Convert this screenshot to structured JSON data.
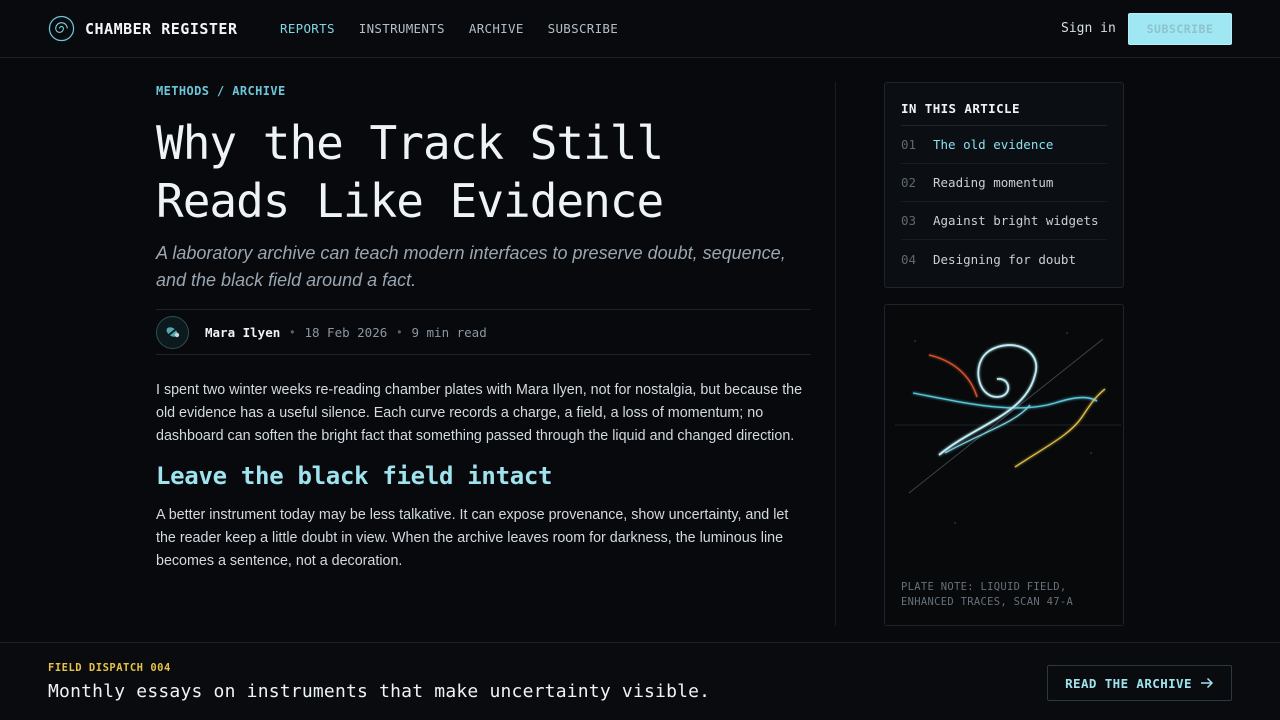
{
  "brand": {
    "name": "CHAMBER REGISTER",
    "logo_icon": "spiral-logo-icon"
  },
  "nav": {
    "items": [
      {
        "label": "REPORTS",
        "active": true
      },
      {
        "label": "INSTRUMENTS",
        "active": false
      },
      {
        "label": "ARCHIVE",
        "active": false
      },
      {
        "label": "SUBSCRIBE",
        "active": false
      }
    ],
    "sign_in": "Sign in",
    "subscribe_button": "SUBSCRIBE"
  },
  "article": {
    "breadcrumb": "METHODS / ARCHIVE",
    "title_line1": "Why the Track Still",
    "title_line2": "Reads Like Evidence",
    "dek": "A laboratory archive can teach modern interfaces to preserve doubt, sequence, and the black field around a fact.",
    "author": "Mara Ilyen",
    "date": "18 Feb 2026",
    "read_time": "9 min read",
    "bullet": "•",
    "paragraph1": "I spent two winter weeks re-reading chamber plates with Mara Ilyen, not for nostalgia, but because the old evidence has a useful silence. Each curve records a charge, a field, a loss of momentum; no dashboard can soften the bright fact that something passed through the liquid and changed direction.",
    "heading2": "Leave the black field intact",
    "paragraph2": "A better instrument today may be less talkative. It can expose provenance, show uncertainty, and let the reader keep a little doubt in view. When the archive leaves room for darkness, the luminous line becomes a sentence, not a decoration."
  },
  "toc": {
    "title": "IN THIS ARTICLE",
    "items": [
      {
        "num": "01",
        "label": "The old evidence",
        "active": true
      },
      {
        "num": "02",
        "label": "Reading momentum",
        "active": false
      },
      {
        "num": "03",
        "label": "Against bright widgets",
        "active": false
      },
      {
        "num": "04",
        "label": "Designing for doubt",
        "active": false
      }
    ]
  },
  "plate": {
    "note_line1": "PLATE NOTE: LIQUID FIELD,",
    "note_line2": "ENHANCED TRACES, SCAN 47-A"
  },
  "footer": {
    "tag": "FIELD DISPATCH 004",
    "text": "Monthly essays on instruments that make uncertainty visible.",
    "button": "READ THE ARCHIVE",
    "button_icon": "arrow-right-icon"
  },
  "colors": {
    "accent": "#7fd6e6",
    "highlight": "#9fe7f2",
    "dispatch": "#e6c24a",
    "track_red": "#e0552f"
  }
}
